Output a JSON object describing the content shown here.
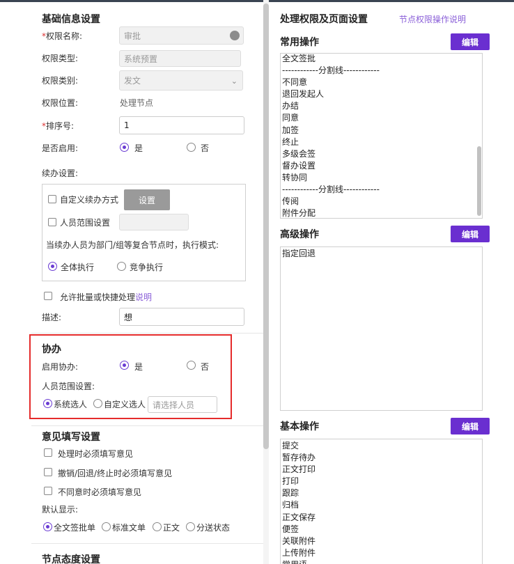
{
  "basic": {
    "title": "基础信息设置",
    "perm_name_label": "权限名称:",
    "perm_name_value": "审批",
    "perm_type_label": "权限类型:",
    "perm_type_value": "系统预置",
    "perm_category_label": "权限类别:",
    "perm_category_value": "发文",
    "perm_position_label": "权限位置:",
    "perm_position_value": "处理节点",
    "sort_label": "排序号:",
    "sort_value": "1",
    "enabled_label": "是否启用:",
    "yes": "是",
    "no": "否",
    "continue_label": "续办设置:",
    "custom_continue": "自定义续办方式",
    "setup_button": "设置",
    "person_range": "人员范围设置",
    "mode_text": "当续办人员为部门/组等复合节点时，执行模式:",
    "exec_all": "全体执行",
    "exec_compete": "竞争执行",
    "allow_batch": "允许批量或快捷处理",
    "explain": "说明",
    "desc_label": "描述:",
    "desc_value": "想"
  },
  "assist": {
    "title": "协办",
    "enable_label": "启用协办:",
    "yes": "是",
    "no": "否",
    "range_label": "人员范围设置:",
    "system_select": "系统选人",
    "custom_select": "自定义选人",
    "select_placeholder": "请选择人员"
  },
  "opinion": {
    "title": "意见填写设置",
    "opt1": "处理时必须填写意见",
    "opt2": "撤销/回退/终止时必须填写意见",
    "opt3": "不同意时必须填写意见",
    "default_label": "默认显示:",
    "d1": "全文签批单",
    "d2": "标准文单",
    "d3": "正文",
    "d4": "分送状态"
  },
  "node_attitude": {
    "title": "节点态度设置"
  },
  "right": {
    "title": "处理权限及页面设置",
    "help_link": "节点权限操作说明",
    "common_title": "常用操作",
    "edit": "编辑",
    "common_items": [
      "全文签批",
      "------------分割线------------",
      "不同意",
      "退回发起人",
      "办结",
      "同意",
      "加签",
      "终止",
      "多级会签",
      "督办设置",
      "转协同",
      "------------分割线------------",
      "传阅",
      "附件分配"
    ],
    "advanced_title": "高级操作",
    "advanced_items": [
      "指定回退"
    ],
    "basic_title": "基本操作",
    "basic_items": [
      "提交",
      "暂存待办",
      "正文打印",
      "打印",
      "跟踪",
      "归档",
      "正文保存",
      "便签",
      "关联附件",
      "上传附件",
      "常用语"
    ]
  }
}
